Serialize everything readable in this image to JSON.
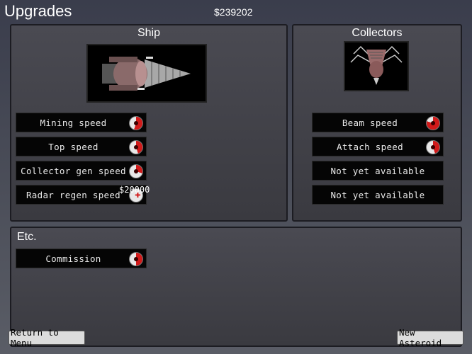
{
  "header": {
    "title": "Upgrades",
    "money": "$239202"
  },
  "ship_panel": {
    "title": "Ship",
    "upgrades": [
      {
        "label": "Mining speed",
        "level": 0.55
      },
      {
        "label": "Top speed",
        "level": 0.45
      },
      {
        "label": "Collector gen speed",
        "level": 0.3
      },
      {
        "label": "Radar regen speed",
        "level": 0.0
      }
    ],
    "hover_cost": "$20000"
  },
  "collectors_panel": {
    "title": "Collectors",
    "upgrades": [
      {
        "label": "Beam speed",
        "level": 0.8
      },
      {
        "label": "Attach speed",
        "level": 0.45
      },
      {
        "label": "Not yet available"
      },
      {
        "label": "Not yet available"
      }
    ]
  },
  "etc_panel": {
    "title": "Etc.",
    "upgrades": [
      {
        "label": "Commission",
        "level": 0.5
      }
    ]
  },
  "footer": {
    "back_label": "Return to Menu",
    "new_label": "New Asteroid"
  },
  "colors": {
    "accent_red": "#d21a1a",
    "panel_bg": "#3f3f46"
  }
}
